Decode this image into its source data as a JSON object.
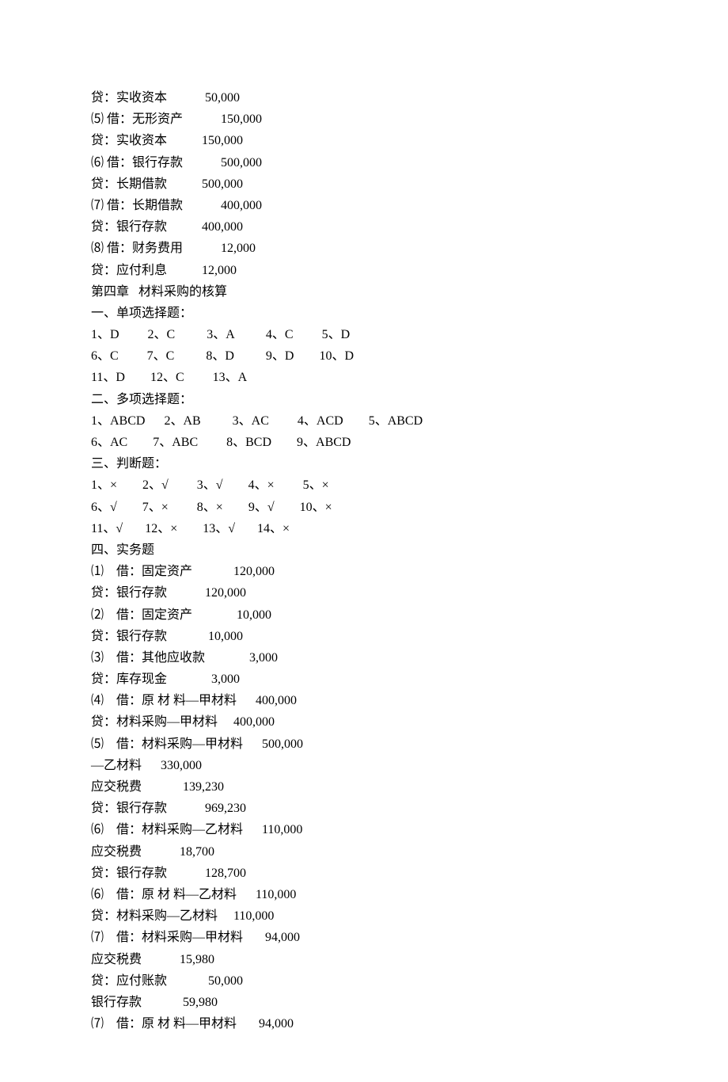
{
  "lines": [
    "贷：实收资本            50,000",
    "⑸ 借：无形资产            150,000",
    "贷：实收资本           150,000",
    "⑹ 借：银行存款            500,000",
    "贷：长期借款           500,000",
    "⑺ 借：长期借款            400,000",
    "贷：银行存款           400,000",
    "⑻ 借：财务费用            12,000",
    "贷：应付利息           12,000",
    "第四章   材料采购的核算",
    "一、单项选择题：",
    "1、D         2、C          3、A          4、C         5、D",
    "6、C         7、C          8、D          9、D        10、D",
    "11、D        12、C         13、A",
    "二、多项选择题：",
    "1、ABCD      2、AB          3、AC         4、ACD        5、ABCD",
    "6、AC        7、ABC         8、BCD        9、ABCD",
    "三、判断题：",
    "1、×        2、√         3、√        4、×         5、×",
    "6、√        7、×         8、×        9、√        10、×",
    "11、√       12、×        13、√       14、×",
    "四、实务题",
    "⑴    借：固定资产             120,000",
    "贷：银行存款            120,000",
    "⑵    借：固定资产              10,000",
    "贷：银行存款             10,000",
    "⑶    借：其他应收款              3,000",
    "贷：库存现金              3,000",
    "⑷    借：原 材 料—甲材料      400,000",
    "贷：材料采购—甲材料     400,000",
    "⑸    借：材料采购—甲材料      500,000",
    "—乙材料      330,000",
    "应交税费             139,230",
    "贷：银行存款            969,230",
    "⑹    借：材料采购—乙材料      110,000",
    "应交税费            18,700",
    "贷：银行存款            128,700",
    "⑹    借：原 材 料—乙材料      110,000",
    "贷：材料采购—乙材料     110,000",
    "⑺    借：材料采购—甲材料       94,000",
    "应交税费            15,980",
    "贷：应付账款             50,000",
    "银行存款             59,980",
    "⑺    借：原 材 料—甲材料       94,000"
  ]
}
